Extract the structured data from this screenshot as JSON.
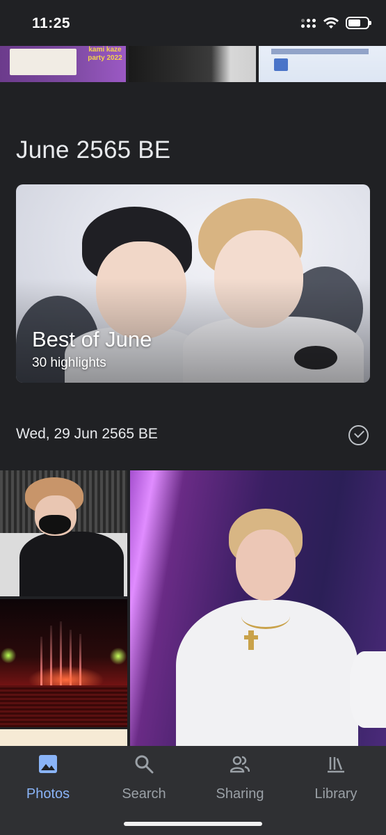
{
  "status_bar": {
    "time": "11:25",
    "icons": [
      "cellular-signal-icon",
      "wifi-icon",
      "battery-icon"
    ]
  },
  "top_strip": {
    "thumbnails": [
      {
        "name": "poster-thumbnail",
        "text": "kami kaze party 2022"
      },
      {
        "name": "jacket-photo-thumbnail"
      },
      {
        "name": "document-thumbnail"
      }
    ]
  },
  "month": {
    "title": "June 2565 BE"
  },
  "highlight": {
    "title": "Best of June",
    "subtitle": "30 highlights"
  },
  "day_section": {
    "date": "Wed, 29 Jun 2565 BE",
    "select_icon": "check-circle-icon"
  },
  "photos": [
    {
      "name": "photo-masked-person"
    },
    {
      "name": "photo-concert-fireworks"
    },
    {
      "name": "photo-partial"
    },
    {
      "name": "photo-person-white-shirt"
    }
  ],
  "nav": {
    "items": [
      {
        "label": "Photos",
        "icon": "photos-icon",
        "active": true
      },
      {
        "label": "Search",
        "icon": "search-icon",
        "active": false
      },
      {
        "label": "Sharing",
        "icon": "sharing-icon",
        "active": false
      },
      {
        "label": "Library",
        "icon": "library-icon",
        "active": false
      }
    ],
    "active_color": "#8ab4f8",
    "inactive_color": "#9aa0a6"
  },
  "colors": {
    "background": "#202124",
    "text": "#e8eaed"
  }
}
